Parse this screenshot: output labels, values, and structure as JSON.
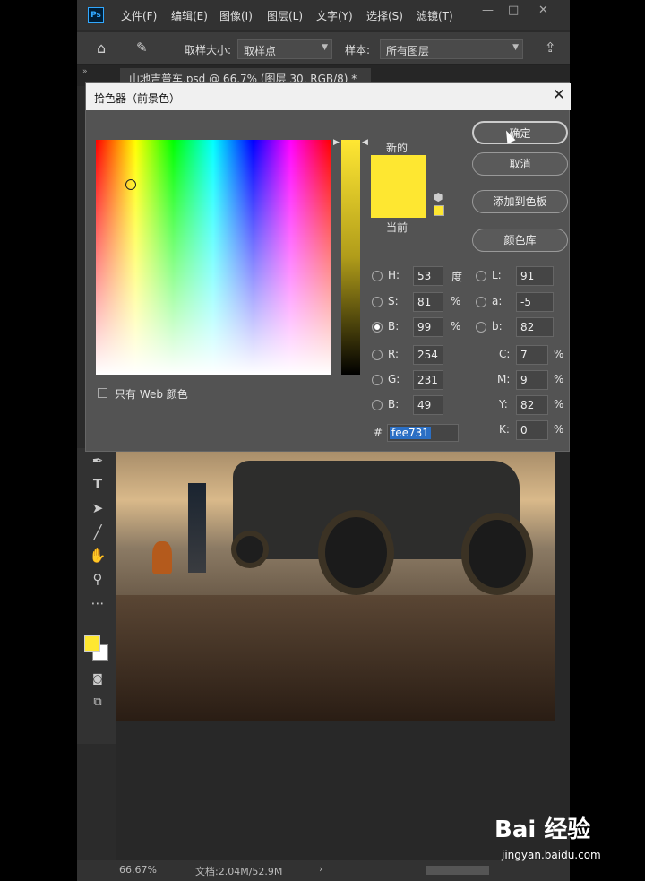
{
  "app": {
    "logo": "Ps",
    "menu": [
      "文件(F)",
      "编辑(E)",
      "图像(I)",
      "图层(L)",
      "文字(Y)",
      "选择(S)",
      "滤镜(T)"
    ],
    "window_controls": [
      "—",
      "□",
      "✕"
    ]
  },
  "options_bar": {
    "sample_size_label": "取样大小:",
    "sample_size_value": "取样点",
    "sample_label": "样本:",
    "sample_value": "所有图层"
  },
  "document_tab": {
    "title": "山地吉普车.psd @ 66.7% (图层 30, RGB/8) *",
    "close": "✕"
  },
  "dialog": {
    "title": "拾色器（前景色）",
    "close": "✕",
    "new_label": "新的",
    "current_label": "当前",
    "new_color": "#fee731",
    "current_color": "#fee731",
    "buttons": [
      "确定",
      "取消",
      "添加到色板",
      "颜色库"
    ],
    "web_only_label": "只有 Web 颜色",
    "hsb": [
      {
        "label": "H:",
        "value": "53",
        "unit": "度"
      },
      {
        "label": "S:",
        "value": "81",
        "unit": "%"
      },
      {
        "label": "B:",
        "value": "99",
        "unit": "%"
      }
    ],
    "rgb": [
      {
        "label": "R:",
        "value": "254"
      },
      {
        "label": "G:",
        "value": "231"
      },
      {
        "label": "B:",
        "value": "49"
      }
    ],
    "lab": [
      {
        "label": "L:",
        "value": "91"
      },
      {
        "label": "a:",
        "value": "-5"
      },
      {
        "label": "b:",
        "value": "82"
      }
    ],
    "cmyk": [
      {
        "label": "C:",
        "value": "7",
        "unit": "%"
      },
      {
        "label": "M:",
        "value": "9",
        "unit": "%"
      },
      {
        "label": "Y:",
        "value": "82",
        "unit": "%"
      },
      {
        "label": "K:",
        "value": "0",
        "unit": "%"
      }
    ],
    "hex_label": "#",
    "hex_value": "fee731"
  },
  "status": {
    "zoom": "66.67%",
    "doc": "文档:2.04M/52.9M"
  },
  "watermark": {
    "brand": "Bai 经验",
    "url": "jingyan.baidu.com"
  }
}
